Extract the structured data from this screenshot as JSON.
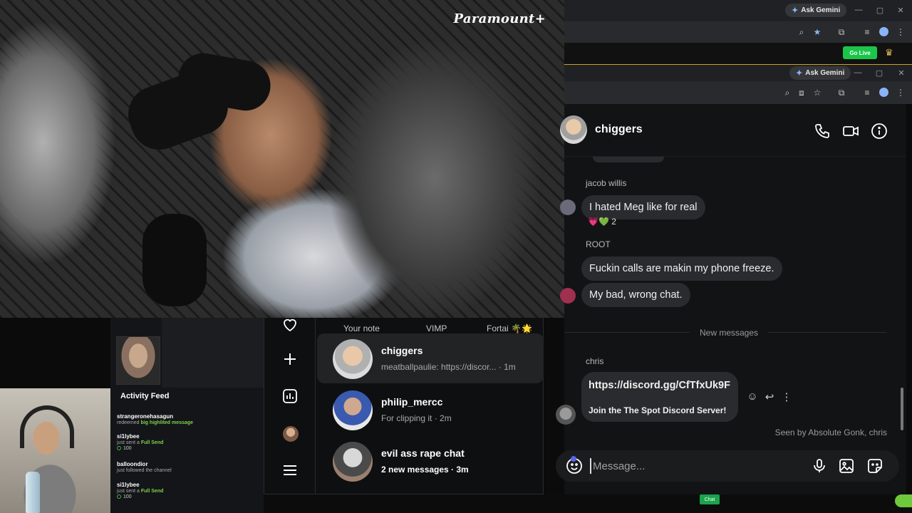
{
  "video": {
    "brand": "Paramount+"
  },
  "browser": {
    "gemini_label": "Ask Gemini",
    "go_live": "Go Live"
  },
  "chat": {
    "contact_name": "chiggers",
    "messages": [
      {
        "sender": "jacob willis",
        "text": "I hated Meg like for real",
        "reaction": "💗💚 2"
      },
      {
        "sender": "ROOT",
        "text": "Fuckin calls are makin my phone freeze."
      },
      {
        "text": "My bad, wrong chat."
      }
    ],
    "new_messages_label": "New messages",
    "link_message": {
      "sender": "chris",
      "url": "https://discord.gg/CfTfxUk9F",
      "description": "Join the The Spot Discord Server!"
    },
    "seen_by": "Seen by Absolute Gonk, chris",
    "composer_placeholder": "Message..."
  },
  "inbox": {
    "notes": [
      {
        "label": "Your note"
      },
      {
        "label": "VIMP"
      },
      {
        "label": "Fortai 🌴🌟"
      }
    ],
    "threads": [
      {
        "name": "chiggers",
        "preview": "meatballpaulie: https://discor... · 1m",
        "active": true
      },
      {
        "name": "philip_mercc",
        "preview": "For clipping it · 2m"
      },
      {
        "name": "evil ass rape chat",
        "preview": "2 new messages · 3m",
        "unread": true
      }
    ]
  },
  "overlay": {
    "activity_title": "Activity Feed",
    "feed": [
      {
        "user": "strangeronehasagun",
        "action": "redeemed",
        "highlight": "big highlited message"
      },
      {
        "user": "si1lybee",
        "action": "just sent a",
        "highlight": "Full Send",
        "amount": "100"
      },
      {
        "user": "balloondior",
        "action": "just followed the channel"
      },
      {
        "user": "si1lybee",
        "action": "just sent a",
        "highlight": "Full Send",
        "amount": "100"
      }
    ],
    "chat_tab": "Chat"
  },
  "colors": {
    "accent": "#5b63e6",
    "go_live": "#19c64a",
    "bubble": "#2a2b2e"
  }
}
